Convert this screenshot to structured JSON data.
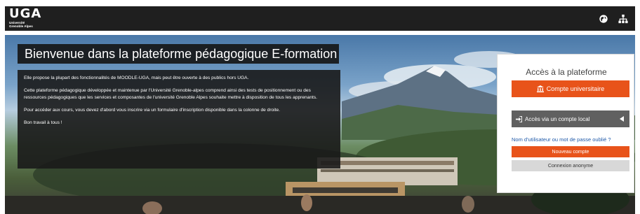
{
  "navbar": {
    "logo_text": "UGA",
    "logo_line1": "Université",
    "logo_line2": "Grenoble Alpes",
    "icons": [
      "globe-icon",
      "sitemap-icon"
    ]
  },
  "welcome": {
    "title": "Bienvenue dans la plateforme pédagogique E-formation",
    "paragraphs": [
      "Elle propose la plupart des fonctionnalités de MOODLE-UGA, mais peut être ouverte à des publics hors UGA.",
      "Cette plateforme pédagogique développée et maintenue par l'Université Grenoble-alpes comprend ainsi des tests de positionnement ou des ressources pédagogiques que les services et composantes de l'université Grenoble Alpes souhaite mettre à disposition de tous les apprenants.",
      "Pour accéder aux cours, vous devez d'abord vous inscrire via un formulaire d'inscription disponible dans la colonne de droite.",
      "Bon travail à tous !"
    ]
  },
  "login": {
    "title": "Accès à la plateforme",
    "university_button": "Compte universitaire",
    "local_button": "Accès via un compte local",
    "forgot_link": "Nom d'utilisateur ou mot de passe oublié ?",
    "new_account_button": "Nouveau compte",
    "anonymous_button": "Connexion anonyme"
  },
  "colors": {
    "navbar": "#1f1f1f",
    "accent": "#e8531a",
    "local_button": "#606060",
    "link": "#1d58a8"
  }
}
